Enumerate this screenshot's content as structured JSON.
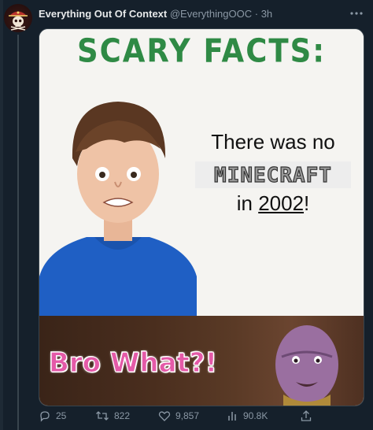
{
  "tweet": {
    "author_name": "Everything Out Of Context",
    "author_handle": "@EverythingOOC",
    "separator": "·",
    "time": "3h",
    "more_icon": "more-icon"
  },
  "meme": {
    "title": "SCARY FACTS:",
    "line1": "There was no",
    "logo_text": "MINECRAFT",
    "line3_prefix": "in ",
    "line3_year": "2002",
    "line3_suffix": "!",
    "reaction": "Bro What?!"
  },
  "actions": {
    "replies": "25",
    "retweets": "822",
    "likes": "9,857",
    "views": "90.8K"
  }
}
